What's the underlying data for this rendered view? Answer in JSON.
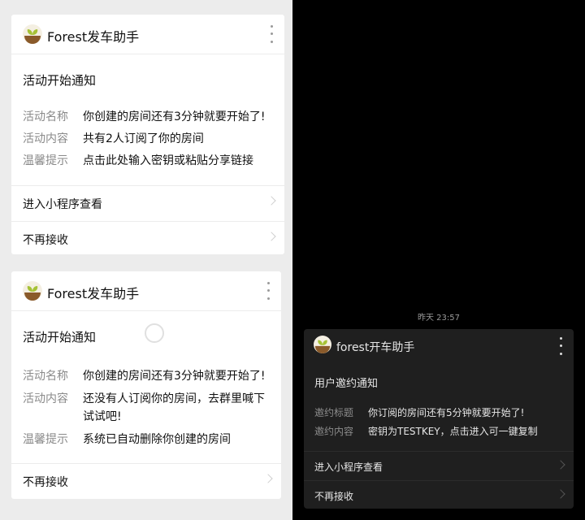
{
  "card_top": {
    "brand": "Forest发车助手",
    "title": "活动开始通知",
    "fields": [
      {
        "key": "活动名称",
        "value": "你创建的房间还有3分钟就要开始了!"
      },
      {
        "key": "活动内容",
        "value": "共有2人订阅了你的房间"
      },
      {
        "key": "温馨提示",
        "value": "点击此处输入密钥或粘贴分享链接"
      }
    ],
    "actions": [
      {
        "label": "进入小程序查看"
      },
      {
        "label": "不再接收"
      }
    ]
  },
  "card_bottom": {
    "brand": "Forest发车助手",
    "title": "活动开始通知",
    "fields": [
      {
        "key": "活动名称",
        "value": "你创建的房间还有3分钟就要开始了!"
      },
      {
        "key": "活动内容",
        "value": "还没有人订阅你的房间，去群里喊下试试吧!"
      },
      {
        "key": "温馨提示",
        "value": "系统已自动删除你创建的房间"
      }
    ],
    "actions": [
      {
        "label": "不再接收"
      }
    ]
  },
  "dark": {
    "timestamp": "昨天 23:57",
    "brand": "forest开车助手",
    "title": "用户邀约通知",
    "fields": [
      {
        "key": "邀约标题",
        "value": "你订阅的房间还有5分钟就要开始了!"
      },
      {
        "key": "邀约内容",
        "value": "密钥为TESTKEY，点击进入可一键复制"
      }
    ],
    "actions": [
      {
        "label": "进入小程序查看"
      },
      {
        "label": "不再接收"
      }
    ]
  },
  "colors": {
    "left_bg": "#ececec",
    "right_bg": "#000000",
    "dark_card_bg": "#1f1f1f",
    "logo_green": "#a6c236",
    "logo_brown": "#8a5a2a"
  },
  "icons": [
    "forest-logo-icon",
    "more-vertical-icon",
    "chevron-right-icon",
    "loading-spinner-icon"
  ]
}
